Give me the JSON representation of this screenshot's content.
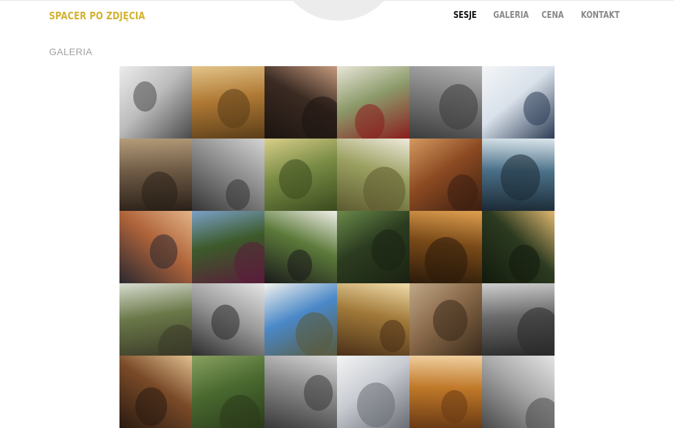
{
  "brand": "SPACER PO ZDJĘCIA",
  "nav": [
    {
      "label": "SESJE",
      "active": true
    },
    {
      "label": "GALERIA",
      "active": false
    },
    {
      "label": "CENA",
      "active": false
    },
    {
      "label": "KONTAKT",
      "active": false
    }
  ],
  "section_title": "GALERIA",
  "colors": {
    "brand": "#d3b22f",
    "nav_active": "#111111",
    "nav_inactive": "#888888",
    "section_title": "#a2a2a2"
  },
  "gallery": [
    {
      "name": "photo-mother-child-bw",
      "bg": "#bdbdbd",
      "accent": "#ececec",
      "dark": "#4a4a4a"
    },
    {
      "name": "photo-couple-autumn-tree",
      "bg": "#b07a35",
      "accent": "#e3c48a",
      "dark": "#5a3d18"
    },
    {
      "name": "photo-couple-embrace",
      "bg": "#3a2a22",
      "accent": "#c59a7d",
      "dark": "#1c1410"
    },
    {
      "name": "photo-child-flowers",
      "bg": "#8c9a6a",
      "accent": "#e8e6d8",
      "dark": "#8a1d1d"
    },
    {
      "name": "photo-face-in-grass-bw",
      "bg": "#7c7c7c",
      "accent": "#b4b4b4",
      "dark": "#3c3c3c"
    },
    {
      "name": "photo-family-snow-sled",
      "bg": "#d9e1ea",
      "accent": "#f4f6f8",
      "dark": "#2c3c55"
    },
    {
      "name": "photo-run-old-building",
      "bg": "#6e5a45",
      "accent": "#b59c7a",
      "dark": "#2a2018"
    },
    {
      "name": "photo-two-women-bw",
      "bg": "#8d8d8d",
      "accent": "#d4d4d4",
      "dark": "#353535"
    },
    {
      "name": "photo-park-walk",
      "bg": "#7a8c45",
      "accent": "#d9cf8a",
      "dark": "#3a4a1e"
    },
    {
      "name": "photo-baby-white-dress",
      "bg": "#9aa060",
      "accent": "#f0eadc",
      "dark": "#5c5a30"
    },
    {
      "name": "photo-horse-cowboy",
      "bg": "#8c4a22",
      "accent": "#d49a60",
      "dark": "#3a1e10"
    },
    {
      "name": "photo-sea-rocks",
      "bg": "#4a7088",
      "accent": "#dbe6ec",
      "dark": "#1c2a35"
    },
    {
      "name": "photo-couple-old-town",
      "bg": "#b0643a",
      "accent": "#e4b488",
      "dark": "#2a2830"
    },
    {
      "name": "photo-girls-kiss-flowers",
      "bg": "#3c5a2a",
      "accent": "#7aa0c8",
      "dark": "#5a1e3a"
    },
    {
      "name": "photo-boy-dalmatian",
      "bg": "#5c7a3a",
      "accent": "#f2f0ea",
      "dark": "#1a1a1a"
    },
    {
      "name": "photo-boy-lying-grass",
      "bg": "#2c3c20",
      "accent": "#6a8a4a",
      "dark": "#1a2212"
    },
    {
      "name": "photo-golden-forest",
      "bg": "#7a4a18",
      "accent": "#e0a050",
      "dark": "#2a1a0a"
    },
    {
      "name": "photo-curly-boy-portrait",
      "bg": "#2c3a20",
      "accent": "#e0b870",
      "dark": "#121a0c"
    },
    {
      "name": "photo-boardwalk-piggyback",
      "bg": "#6a7848",
      "accent": "#d8dcd0",
      "dark": "#3a3a28"
    },
    {
      "name": "photo-newborn-bath-bw",
      "bg": "#9c9c9c",
      "accent": "#e6e6e6",
      "dark": "#2c2c2c"
    },
    {
      "name": "photo-sheep-sky",
      "bg": "#4a88c8",
      "accent": "#f2f2ee",
      "dark": "#5a5a3a"
    },
    {
      "name": "photo-woman-sunset",
      "bg": "#a07838",
      "accent": "#f0dca8",
      "dark": "#4a3018"
    },
    {
      "name": "photo-hikers-trail",
      "bg": "#8a6a4a",
      "accent": "#c0a888",
      "dark": "#3a2a1a"
    },
    {
      "name": "photo-baby-feet-bw",
      "bg": "#6a6a6a",
      "accent": "#cfcfcf",
      "dark": "#2a2a2a"
    },
    {
      "name": "photo-cowboy-barn",
      "bg": "#7a4a28",
      "accent": "#e0c090",
      "dark": "#2a1a10"
    },
    {
      "name": "photo-green-meadow",
      "bg": "#4a6a30",
      "accent": "#88a060",
      "dark": "#2a3a1a"
    },
    {
      "name": "photo-trees-bw",
      "bg": "#8a8a8a",
      "accent": "#d8d8d8",
      "dark": "#3a3a3a"
    },
    {
      "name": "photo-blossom-branches",
      "bg": "#c8ccd2",
      "accent": "#f4f4f4",
      "dark": "#6a6e74"
    },
    {
      "name": "photo-mother-autumn-leaves",
      "bg": "#c07828",
      "accent": "#f0d0a0",
      "dark": "#6a3a14"
    },
    {
      "name": "photo-field-bw",
      "bg": "#a8a8a8",
      "accent": "#e4e4e4",
      "dark": "#4a4a4a"
    }
  ]
}
